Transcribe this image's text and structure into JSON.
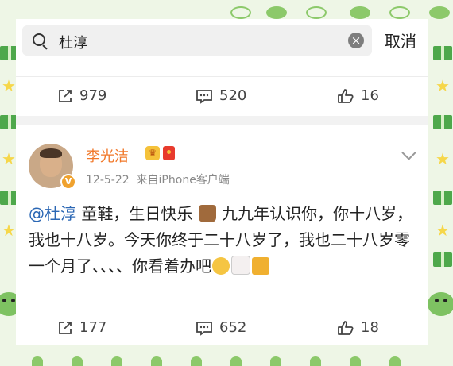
{
  "search": {
    "query": "杜淳",
    "cancel_label": "取消"
  },
  "prev_post": {
    "repost_count": "979",
    "comment_count": "520",
    "like_count": "16"
  },
  "post": {
    "author": "李光洁",
    "timestamp": "12-5-22",
    "source": "来自iPhone客户端",
    "mention": "@杜淳",
    "text_1": "童鞋，生日快乐",
    "text_2": "九九年认识你，你十八岁，我也十八岁。今天你终于二十八岁了，我也二十八岁零一个月了、、、、你看着办吧",
    "emoji_1": "cake-emoji",
    "emoji_2": "grin-emoji",
    "emoji_3": "birthday-cake-emoji",
    "emoji_4": "beer-emoji",
    "verified_badge": "V",
    "repost_count": "177",
    "comment_count": "652",
    "like_count": "18"
  },
  "colors": {
    "author": "#f1782a",
    "mention": "#2b67b4",
    "border_green": "#8cc96a"
  }
}
